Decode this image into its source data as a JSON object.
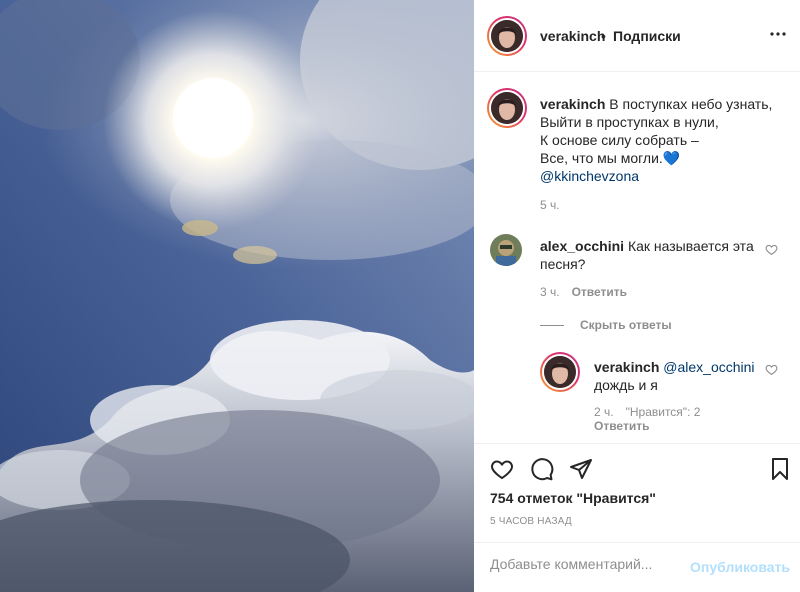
{
  "header": {
    "username": "verakinch",
    "separator": "•",
    "follow_label": "Подписки"
  },
  "caption": {
    "username": "verakinch",
    "lines": [
      "В поступках небо узнать,",
      "Выйти в проступках в нули,",
      "К основе силу собрать –",
      "Все, что мы могли."
    ],
    "emoji": "💙",
    "mention": "@kkinchevzona",
    "time": "5 ч."
  },
  "comments": [
    {
      "username": "alex_occhini",
      "text": "Как называется эта песня?",
      "time": "3 ч.",
      "reply_label": "Ответить"
    }
  ],
  "hide_replies_label": "Скрыть ответы",
  "reply": {
    "username": "verakinch",
    "mention": "@alex_occhini",
    "text": "дождь и я",
    "time": "2 ч.",
    "likes": "\"Нравится\": 2",
    "reply_label": "Ответить"
  },
  "post": {
    "likes_text": "754 отметок \"Нравится\"",
    "time_ago": "5 ЧАСОВ НАЗАД"
  },
  "add_comment": {
    "placeholder": "Добавьте комментарий...",
    "post_label": "Опубликовать"
  },
  "icons": {
    "more": "more-horizontal-icon",
    "like": "heart-icon",
    "comment": "comment-icon",
    "share": "paper-plane-icon",
    "save": "bookmark-icon"
  },
  "colors": {
    "link": "#00376b",
    "muted": "#8e8e8e",
    "post_button": "#b2dffc",
    "sky": "#3d5687"
  }
}
